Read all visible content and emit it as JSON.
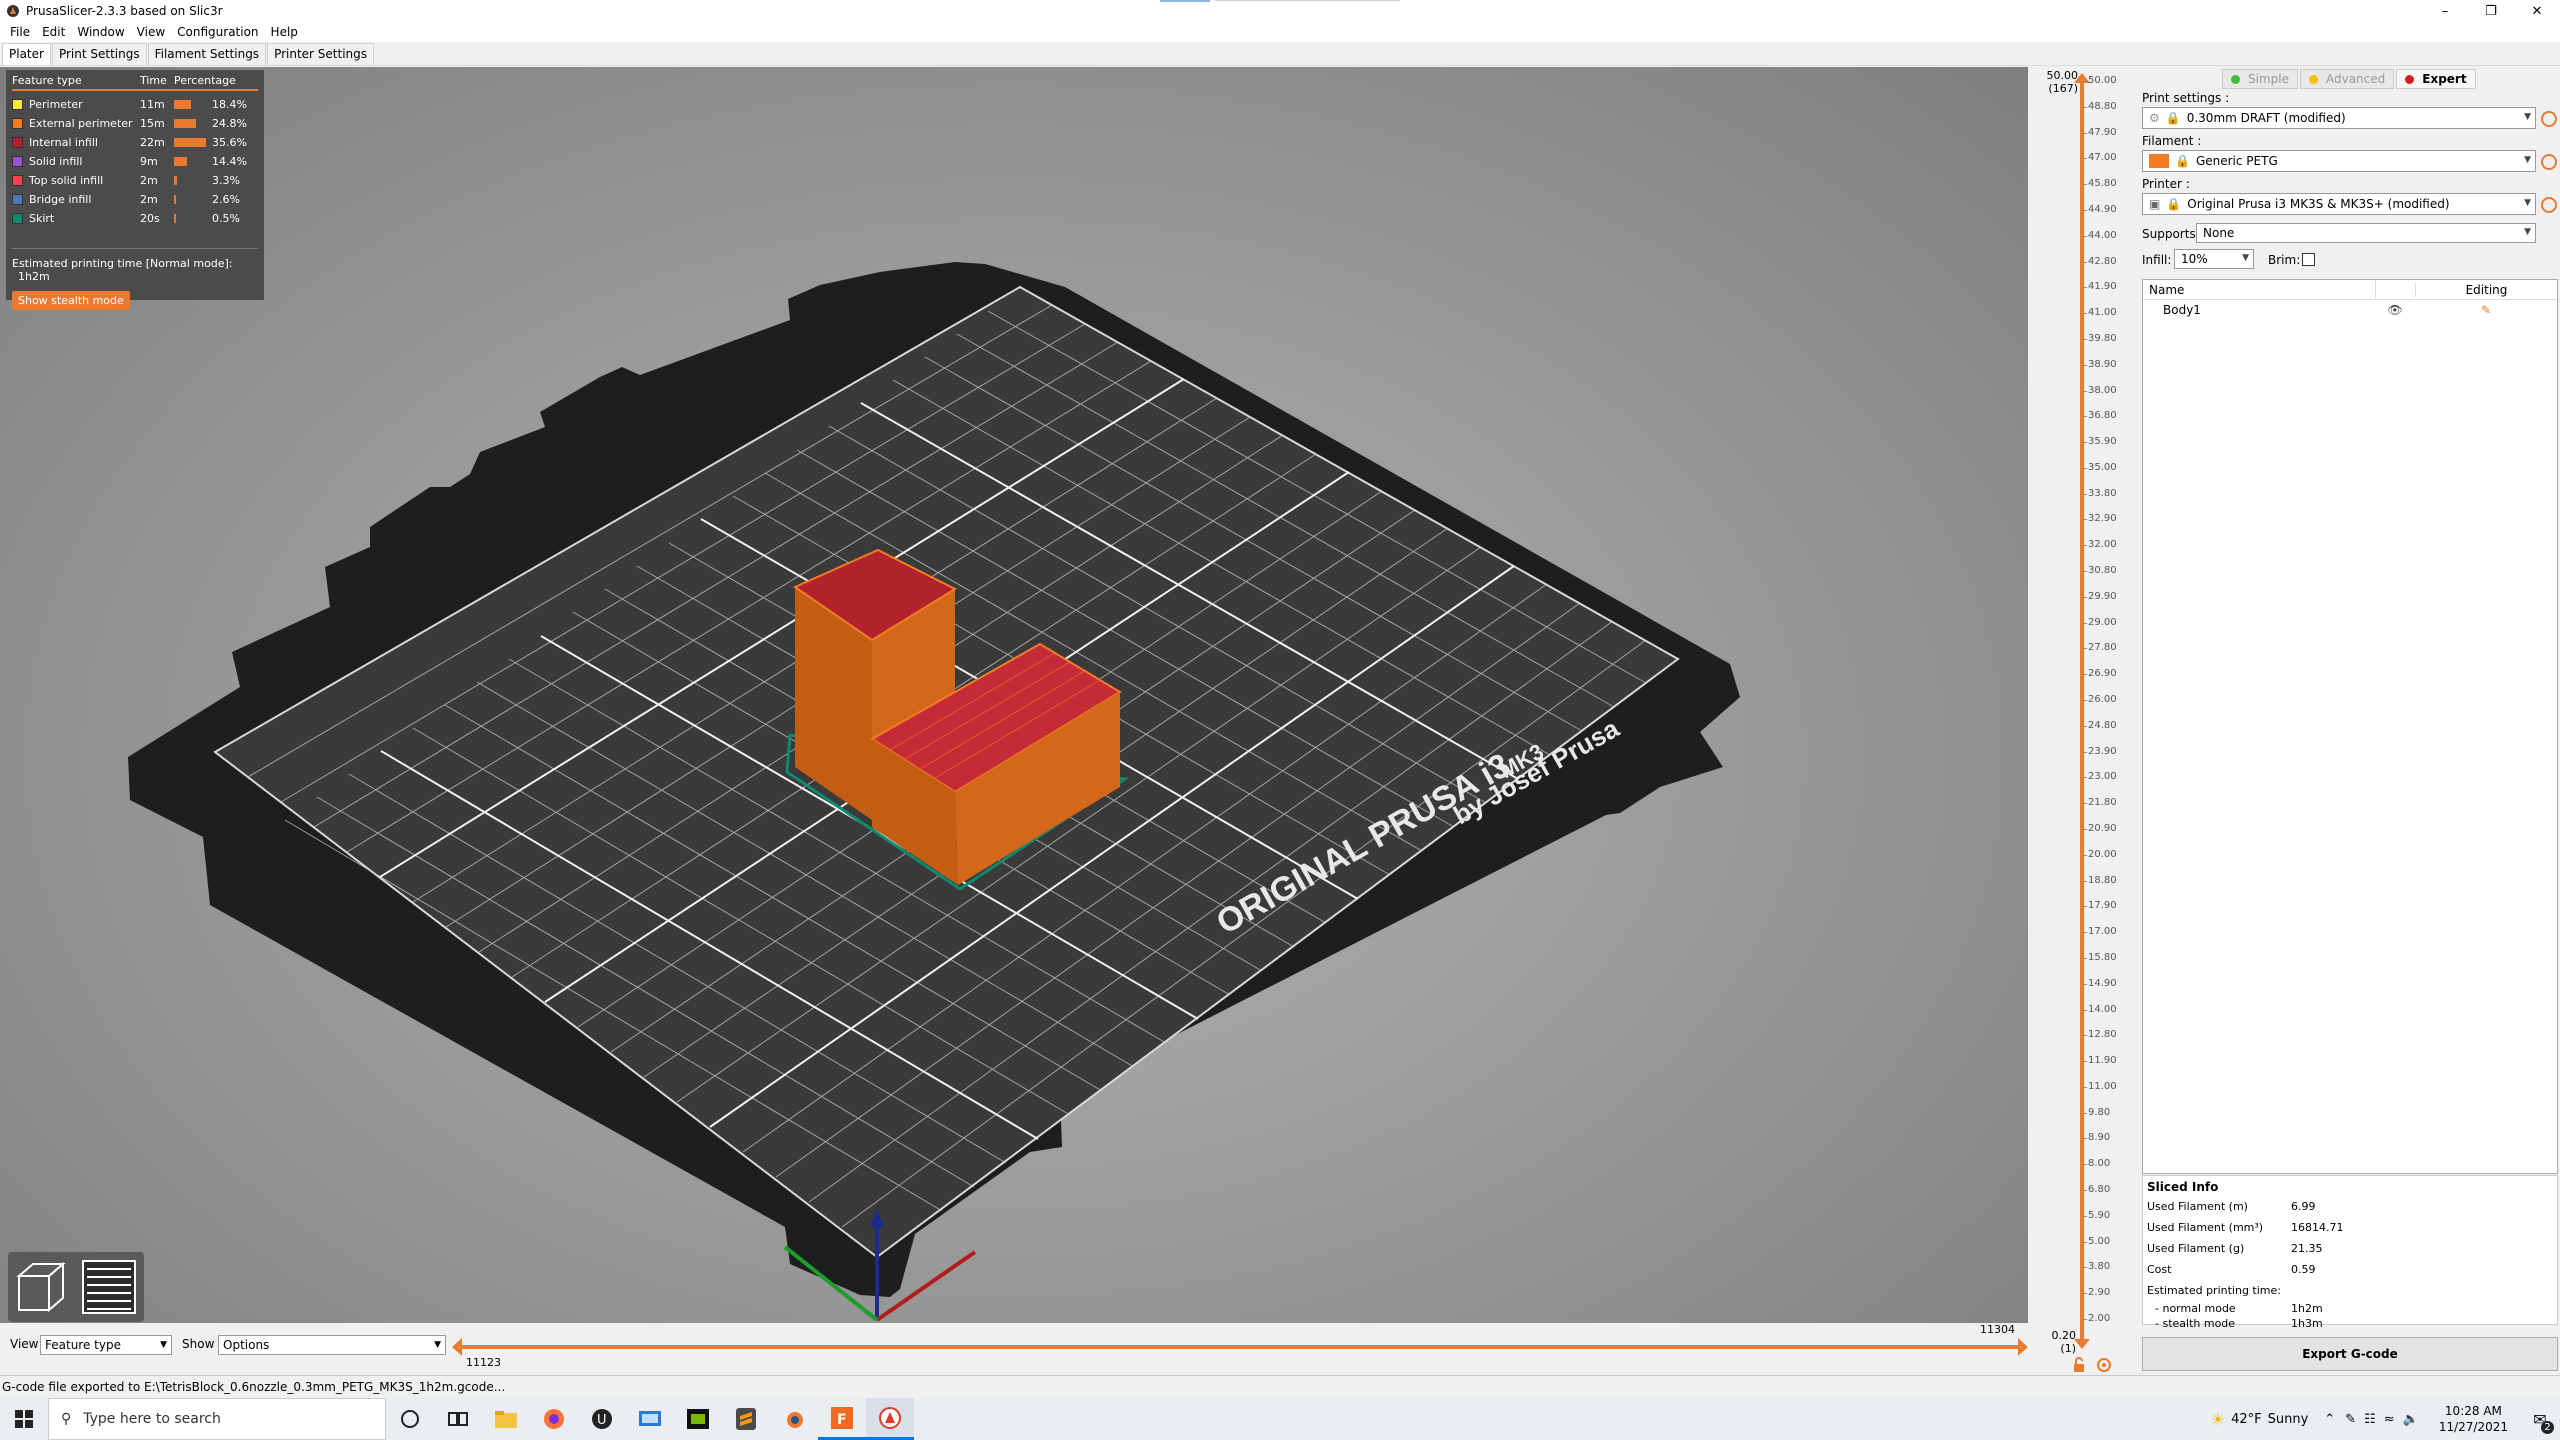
{
  "window": {
    "title": "PrusaSlicer-2.3.3 based on Slic3r"
  },
  "menu": [
    "File",
    "Edit",
    "Window",
    "View",
    "Configuration",
    "Help"
  ],
  "tabs": [
    "Plater",
    "Print Settings",
    "Filament Settings",
    "Printer Settings"
  ],
  "legend": {
    "headers": [
      "Feature type",
      "Time",
      "Percentage"
    ],
    "rows": [
      {
        "name": "Perimeter",
        "time": "11m",
        "pct": "18.4%",
        "pctValue": 18.4,
        "color": "#ffe63f"
      },
      {
        "name": "External perimeter",
        "time": "15m",
        "pct": "24.8%",
        "pctValue": 24.8,
        "color": "#f37c25"
      },
      {
        "name": "Internal infill",
        "time": "22m",
        "pct": "35.6%",
        "pctValue": 35.6,
        "color": "#b2222d"
      },
      {
        "name": "Solid infill",
        "time": "9m",
        "pct": "14.4%",
        "pctValue": 14.4,
        "color": "#9b4fd6"
      },
      {
        "name": "Top solid infill",
        "time": "2m",
        "pct": "3.3%",
        "pctValue": 3.3,
        "color": "#f04848"
      },
      {
        "name": "Bridge infill",
        "time": "2m",
        "pct": "2.6%",
        "pctValue": 2.6,
        "color": "#4a7ab8"
      },
      {
        "name": "Skirt",
        "time": "20s",
        "pct": "0.5%",
        "pctValue": 0.5,
        "color": "#10896f"
      }
    ],
    "estimated_label": "Estimated printing time [Normal mode]:",
    "estimated_value": "1h2m",
    "stealth_button": "Show stealth mode"
  },
  "bed": {
    "brand_line1": "ORIGINAL PRUSA i3",
    "brand_line1b": "MK3",
    "brand_line2": "by Josef Prusa"
  },
  "bottom": {
    "view_label": "View",
    "view_value": "Feature type",
    "show_label": "Show",
    "show_value": "Options",
    "hslider_left": "11123",
    "hslider_right": "11304"
  },
  "vslider": {
    "top_value": "50.00",
    "top_layer": "(167)",
    "bottom_value": "0.20",
    "bottom_layer": "(1)",
    "ticks": [
      "50.00",
      "48.80",
      "47.90",
      "47.00",
      "45.80",
      "44.90",
      "44.00",
      "42.80",
      "41.90",
      "41.00",
      "39.80",
      "38.90",
      "38.00",
      "36.80",
      "35.90",
      "35.00",
      "33.80",
      "32.90",
      "32.00",
      "30.80",
      "29.90",
      "29.00",
      "27.80",
      "26.90",
      "26.00",
      "24.80",
      "23.90",
      "23.00",
      "21.80",
      "20.90",
      "20.00",
      "18.80",
      "17.90",
      "17.00",
      "15.80",
      "14.90",
      "14.00",
      "12.80",
      "11.90",
      "11.00",
      "9.80",
      "8.90",
      "8.00",
      "6.80",
      "5.90",
      "5.00",
      "3.80",
      "2.90",
      "2.00"
    ]
  },
  "right": {
    "modes": [
      {
        "label": "Simple",
        "color": "#3ebe3e",
        "active": false
      },
      {
        "label": "Advanced",
        "color": "#f2c200",
        "active": false
      },
      {
        "label": "Expert",
        "color": "#d41e1e",
        "active": true
      }
    ],
    "print_settings_label": "Print settings :",
    "print_settings_value": "0.30mm DRAFT (modified)",
    "filament_label": "Filament :",
    "filament_value": "Generic PETG",
    "filament_color": "#f37c25",
    "printer_label": "Printer :",
    "printer_value": "Original Prusa i3 MK3S & MK3S+ (modified)",
    "supports_label": "Supports:",
    "supports_value": "None",
    "infill_label": "Infill:",
    "infill_value": "10%",
    "brim_label": "Brim:",
    "list_headers": {
      "name": "Name",
      "editing": "Editing"
    },
    "objects": [
      "Body1"
    ],
    "sliced_title": "Sliced Info",
    "sliced": [
      {
        "k": "Used Filament (m)",
        "v": "6.99"
      },
      {
        "k": "Used Filament (mm³)",
        "v": "16814.71"
      },
      {
        "k": "Used Filament (g)",
        "v": "21.35"
      },
      {
        "k": "Cost",
        "v": "0.59"
      }
    ],
    "est_title": "Estimated printing time:",
    "est_normal_k": "- normal mode",
    "est_normal_v": "1h2m",
    "est_stealth_k": "- stealth mode",
    "est_stealth_v": "1h3m",
    "export_label": "Export G-code"
  },
  "status": "G-code file exported to E:\\TetrisBlock_0.6nozzle_0.3mm_PETG_MK3S_1h2m.gcode...",
  "taskbar": {
    "search_placeholder": "Type here to search",
    "weather_temp": "42°F",
    "weather_text": "Sunny",
    "time": "10:28 AM",
    "date": "11/27/2021",
    "notifications": "2"
  }
}
